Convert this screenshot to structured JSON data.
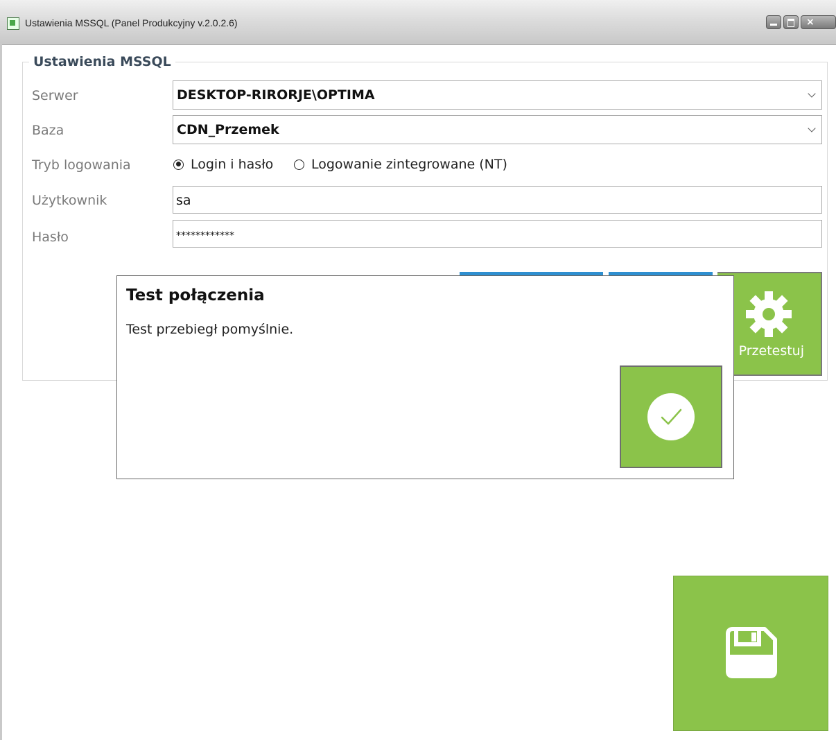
{
  "window": {
    "title": "Ustawienia MSSQL (Panel Produkcyjny v.2.0.2.6)",
    "close_glyph": "×",
    "icons": [
      "app-icon",
      "minimize-icon",
      "maximize-icon",
      "close-icon"
    ]
  },
  "group": {
    "title": "Ustawienia MSSQL"
  },
  "labels": {
    "server": "Serwer",
    "database": "Baza",
    "login_mode": "Tryb logowania",
    "user": "Użytkownik",
    "password": "Hasło"
  },
  "fields": {
    "server": "DESKTOP-RIRORJE\\OPTIMA",
    "database": "CDN_Przemek",
    "user": "sa",
    "password": "************"
  },
  "login_mode": {
    "options": [
      "Login i hasło",
      "Logowanie zintegrowane (NT)"
    ],
    "selected": "Login i hasło"
  },
  "buttons": {
    "test": "Przetestuj"
  },
  "dialog": {
    "title": "Test połączenia",
    "message": "Test przebiegł pomyślnie."
  },
  "colors": {
    "accent_green": "#8bc34a",
    "tab_blue": "#2e8fd0"
  }
}
